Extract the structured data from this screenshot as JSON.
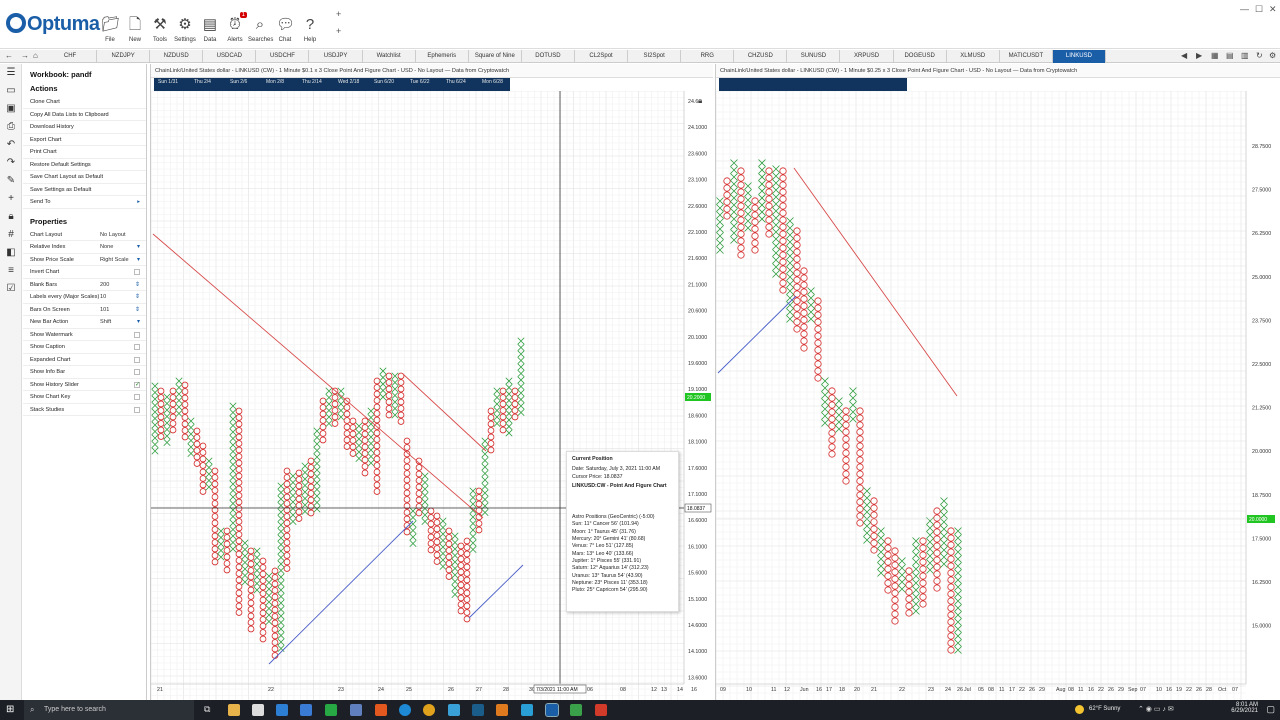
{
  "app": {
    "name": "Optuma"
  },
  "toolbar": [
    {
      "label": "File",
      "icon": "folder-icon"
    },
    {
      "label": "New",
      "icon": "new-icon"
    },
    {
      "label": "Tools",
      "icon": "tools-icon"
    },
    {
      "label": "Settings",
      "icon": "settings-icon"
    },
    {
      "label": "Data",
      "icon": "data-icon"
    },
    {
      "label": "Alerts",
      "icon": "alarm-icon",
      "badge": "1"
    },
    {
      "label": "Searches",
      "icon": "search-icon"
    },
    {
      "label": "Chat",
      "icon": "chat-icon"
    },
    {
      "label": "Help",
      "icon": "help-icon"
    }
  ],
  "tabs": [
    "CHF",
    "NZDJPY",
    "NZDUSD",
    "USDCAD",
    "USDCHF",
    "USDJPY",
    "Watchlist",
    "Ephemeris",
    "Square of Nine",
    "DOTUSD",
    "CL2Spot",
    "SI2Spot",
    "RRG",
    "CHZUSD",
    "SUNUSD",
    "XRPUSD",
    "DOGEUSD",
    "XLMUSD",
    "MATICUSDT",
    "LINKUSD"
  ],
  "active_tab": "LINKUSD",
  "panel": {
    "workbook_title": "Workbook: pandf",
    "actions_title": "Actions",
    "actions": [
      "Clone Chart",
      "Copy All Data Lists to Clipboard",
      "Download History",
      "Export Chart",
      "Print Chart",
      "Restore Default Settings",
      "Save Chart Layout as Default",
      "Save Settings as Default",
      "Send To"
    ],
    "properties_title": "Properties",
    "properties": [
      {
        "label": "Chart Layout",
        "value": "No Layout"
      },
      {
        "label": "Relative Index",
        "value": "None",
        "dropdown": true
      },
      {
        "label": "Show Price Scale",
        "value": "Right Scale",
        "dropdown": true
      },
      {
        "label": "Invert Chart",
        "check": false
      },
      {
        "label": "Blank Bars",
        "value": "200",
        "spinner": true
      },
      {
        "label": "Labels every (Major Scales)",
        "value": "10",
        "spinner": true
      },
      {
        "label": "Bars On Screen",
        "value": "101",
        "spinner": true
      },
      {
        "label": "New Bar Action",
        "value": "Shift",
        "dropdown": true
      },
      {
        "label": "Show Watermark",
        "check": false
      },
      {
        "label": "Show Caption",
        "check": false
      },
      {
        "label": "Expanded Chart",
        "check": false
      },
      {
        "label": "Show Info Bar",
        "check": false
      },
      {
        "label": "Show History Slider",
        "check": true
      },
      {
        "label": "Show Chart Key",
        "check": false
      },
      {
        "label": "Stack Studies",
        "check": false
      }
    ]
  },
  "chart1": {
    "title": "ChainLink/United States dollar - LINKUSD (CW) - 1 Minute $0.1 x 3 Close Point And Figure Chart - USD - No Layout — Data from Cryptowatch",
    "slider_labels": [
      "Sun 1/31",
      "Thu 2/4",
      "Sun 2/6",
      "Mon 2/8",
      "Thu 2/14",
      "Wed 2/18",
      "Sun 6/20",
      "Tue 6/22",
      "Thu 6/24",
      "Mon 6/28"
    ],
    "price_labels": [
      "24.6",
      "24.1000",
      "23.6000",
      "23.1000",
      "22.6000",
      "22.1000",
      "21.6000",
      "21.1000",
      "20.6000",
      "20.1000",
      "19.6000",
      "19.1000",
      "18.6000",
      "18.1000",
      "17.6000",
      "17.1000",
      "16.6000",
      "16.1000",
      "15.6000",
      "15.1000",
      "14.6000",
      "14.1000",
      "13.6000"
    ],
    "current_price_label": "20.2000",
    "cursor_price_label": "18.0837",
    "x_labels": [
      "21",
      "22",
      "23",
      "24",
      "25",
      "26",
      "27",
      "28",
      "30",
      "06",
      "08",
      "12",
      "13",
      "14",
      "16"
    ],
    "cursor_date_label": "7/3/2021 11:00 AM"
  },
  "chart2": {
    "title": "ChainLink/United States dollar - LINKUSD (CW) - 1 Minute $0.25 x 3 Close Point And Figure Chart - USD - No Layout — Data from Cryptowatch",
    "price_labels": [
      "28.7500",
      "27.5000",
      "26.2500",
      "25.0000",
      "23.7500",
      "22.5000",
      "21.2500",
      "20.0000",
      "18.7500",
      "17.5000",
      "16.2500",
      "15.0000"
    ],
    "current_price_label": "20.0000",
    "x_labels": [
      "09",
      "10",
      "11",
      "12",
      "Jun",
      "16",
      "17",
      "18",
      "20",
      "21",
      "22",
      "23",
      "24",
      "26",
      "Jul",
      "05",
      "08",
      "11",
      "17",
      "22",
      "26",
      "29",
      "Aug",
      "08",
      "11",
      "16",
      "22",
      "26",
      "29",
      "Sep",
      "07",
      "10",
      "16",
      "19",
      "22",
      "26",
      "28",
      "Oct",
      "07"
    ]
  },
  "tooltip": {
    "title": "Current Position",
    "date": "Date: Saturday, July 3, 2021 11:00 AM",
    "cursor_price": "Cursor Price: 18.0837",
    "chart_name": "LINKUSD:CW - Point And Figure Chart",
    "astro_title": "Astro Positions (GeoCentric) (-5:00)",
    "astro": [
      "Sun: 11° Cancer 56' (101.94)",
      "Moon: 1° Taurus 45' (31.76)",
      "Mercury: 20° Gemini 41' (80.68)",
      "Venus: 7° Leo 51' (127.85)",
      "Mars: 13° Leo 40' (133.66)",
      "Jupiter: 1° Pisces 55' (331.91)",
      "Saturn: 12° Aquarius 14' (312.23)",
      "Uranus: 13° Taurus 54' (43.90)",
      "Neptune: 23° Pisces 11' (353.18)",
      "Pluto: 25° Capricorn 54' (295.90)"
    ]
  },
  "taskbar": {
    "search_placeholder": "Type here to search",
    "weather": "62°F  Sunny",
    "time": "8:01 AM",
    "date": "6/29/2021"
  },
  "colors": {
    "x": "#2e9e3e",
    "o": "#d62a2a",
    "trend_red": "#d84a4a",
    "trend_blue": "#4a5fc8",
    "slider": "#10345e",
    "accent": "#1b5ea8"
  }
}
